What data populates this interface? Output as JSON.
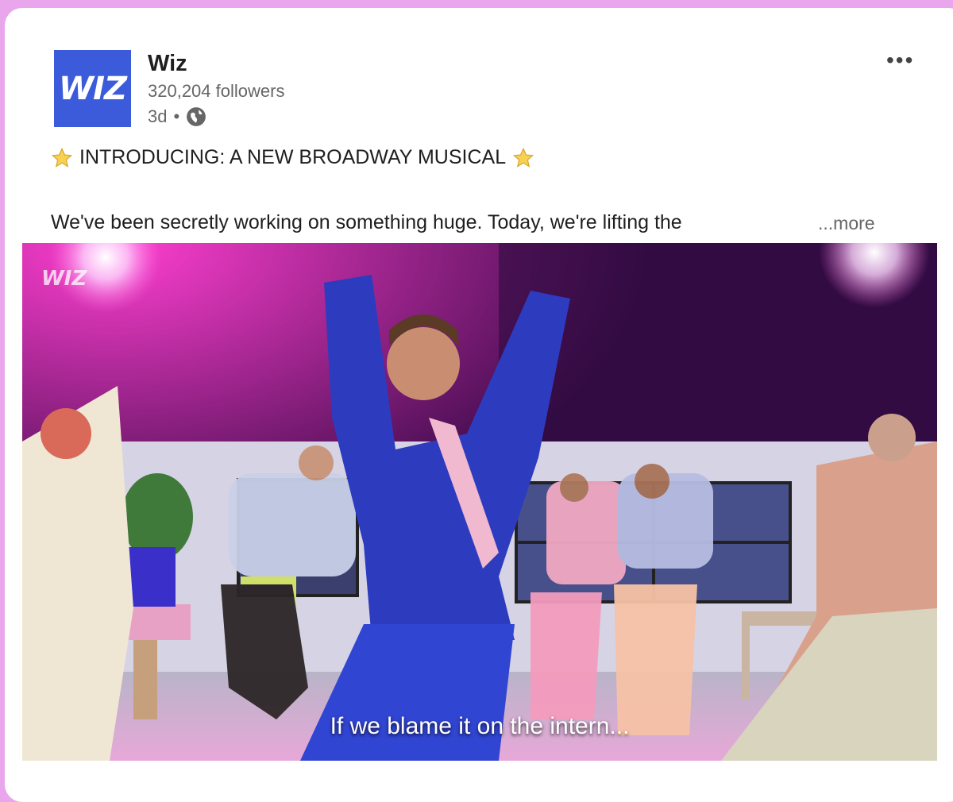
{
  "post": {
    "author": {
      "name": "Wiz",
      "followers": "320,204 followers",
      "time": "3d",
      "separator": "•",
      "visibility_icon": "globe-icon",
      "logo_text": "WIZ",
      "logo_color": "#3b5bdb"
    },
    "menu_label": "•••",
    "headline": "INTRODUCING: A NEW BROADWAY MUSICAL",
    "headline_icon": "star-icon",
    "body": "We've been secretly working on something huge. Today, we're lifting the",
    "see_more": "...more",
    "video": {
      "watermark": "WIZ",
      "subtitle": "If we blame it on the intern..."
    }
  },
  "colors": {
    "page_background": "#e9a6ec",
    "card": "#ffffff",
    "accent": "#3b5bdb"
  }
}
